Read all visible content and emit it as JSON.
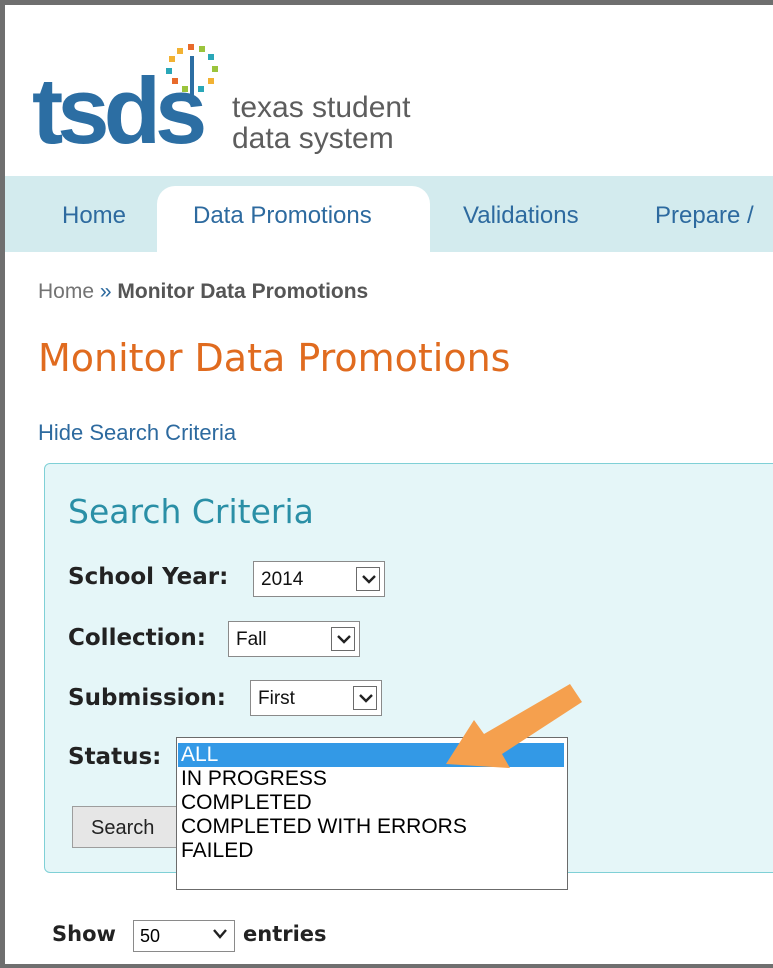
{
  "logo": {
    "wordmark": "tsds",
    "tagline_line1": "texas student",
    "tagline_line2": "data system"
  },
  "nav": {
    "items": [
      {
        "label": "Home"
      },
      {
        "label": "Data Promotions"
      },
      {
        "label": "Validations"
      },
      {
        "label": "Prepare /"
      }
    ],
    "active_index": 1
  },
  "breadcrumb": {
    "home": "Home",
    "separator": "»",
    "current": "Monitor Data Promotions"
  },
  "page": {
    "title": "Monitor Data Promotions",
    "toggle_link": "Hide Search Criteria"
  },
  "search_criteria": {
    "title": "Search Criteria",
    "school_year": {
      "label": "School Year:",
      "value": "2014"
    },
    "collection": {
      "label": "Collection:",
      "value": "Fall"
    },
    "submission": {
      "label": "Submission:",
      "value": "First"
    },
    "status": {
      "label": "Status:",
      "options": [
        "ALL",
        "IN PROGRESS",
        "COMPLETED",
        "COMPLETED WITH ERRORS",
        "FAILED"
      ],
      "selected": "ALL"
    },
    "search_button": "Search"
  },
  "table_controls": {
    "show_label": "Show",
    "page_size": "50",
    "entries_label": "entries"
  },
  "colors": {
    "brand_blue": "#2c6ea3",
    "title_orange": "#e06b1f",
    "nav_bg": "#d3ebee",
    "panel_bg": "#e5f6f8",
    "selected_option": "#3399e6",
    "callout_arrow": "#f5a04e"
  }
}
